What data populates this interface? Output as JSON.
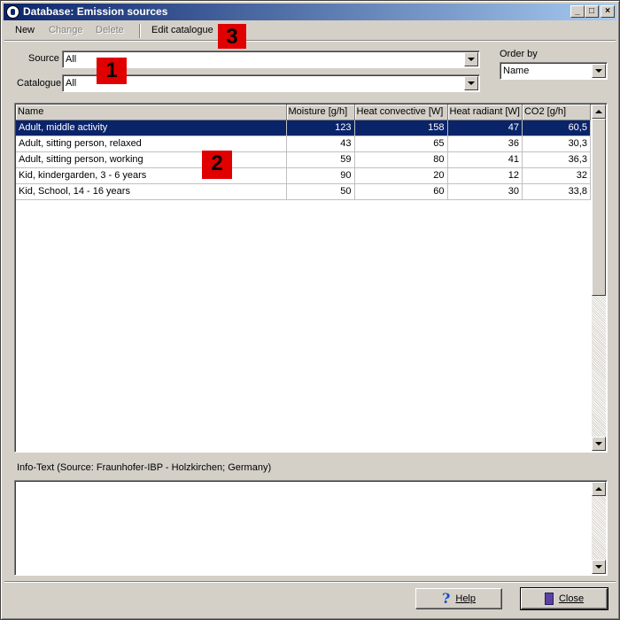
{
  "window": {
    "title": "Database: Emission sources",
    "controls": {
      "minimize": "_",
      "maximize": "□",
      "close": "×"
    }
  },
  "menu": {
    "items": [
      {
        "label": "New",
        "enabled": true
      },
      {
        "label": "Change",
        "enabled": false
      },
      {
        "label": "Delete",
        "enabled": false
      },
      {
        "label": "Edit catalogue",
        "enabled": true
      }
    ]
  },
  "filters": {
    "source_label": "Source",
    "source_value": "All",
    "catalogue_label": "Catalogue",
    "catalogue_value": "All",
    "order_label": "Order by",
    "order_value": "Name"
  },
  "markers": [
    "1",
    "2",
    "3"
  ],
  "table": {
    "columns": [
      "Name",
      "Moisture [g/h]",
      "Heat convective [W]",
      "Heat radiant [W]",
      "CO2 [g/h]"
    ],
    "rows": [
      {
        "name": "Adult, middle activity",
        "moisture": "123",
        "convective": "158",
        "radiant": "47",
        "co2": "60,5",
        "selected": true
      },
      {
        "name": "Adult, sitting person, relaxed",
        "moisture": "43",
        "convective": "65",
        "radiant": "36",
        "co2": "30,3"
      },
      {
        "name": "Adult, sitting person, working",
        "moisture": "59",
        "convective": "80",
        "radiant": "41",
        "co2": "36,3"
      },
      {
        "name": "Kid, kindergarden, 3 - 6 years",
        "moisture": "90",
        "convective": "20",
        "radiant": "12",
        "co2": "32"
      },
      {
        "name": "Kid, School, 14 - 16 years",
        "moisture": "50",
        "convective": "60",
        "radiant": "30",
        "co2": "33,8"
      }
    ]
  },
  "info": {
    "label": "Info-Text  (Source: Fraunhofer-IBP - Holzkirchen; Germany)",
    "text": ""
  },
  "buttons": {
    "help": "Help",
    "close": "Close"
  },
  "colors": {
    "selection": "#0a246a",
    "marker": "#e00000",
    "face": "#d4d0c8"
  },
  "icons": [
    "app-icon",
    "help-icon",
    "close-door-icon",
    "chevron-down-icon",
    "scroll-up-icon",
    "scroll-down-icon"
  ]
}
